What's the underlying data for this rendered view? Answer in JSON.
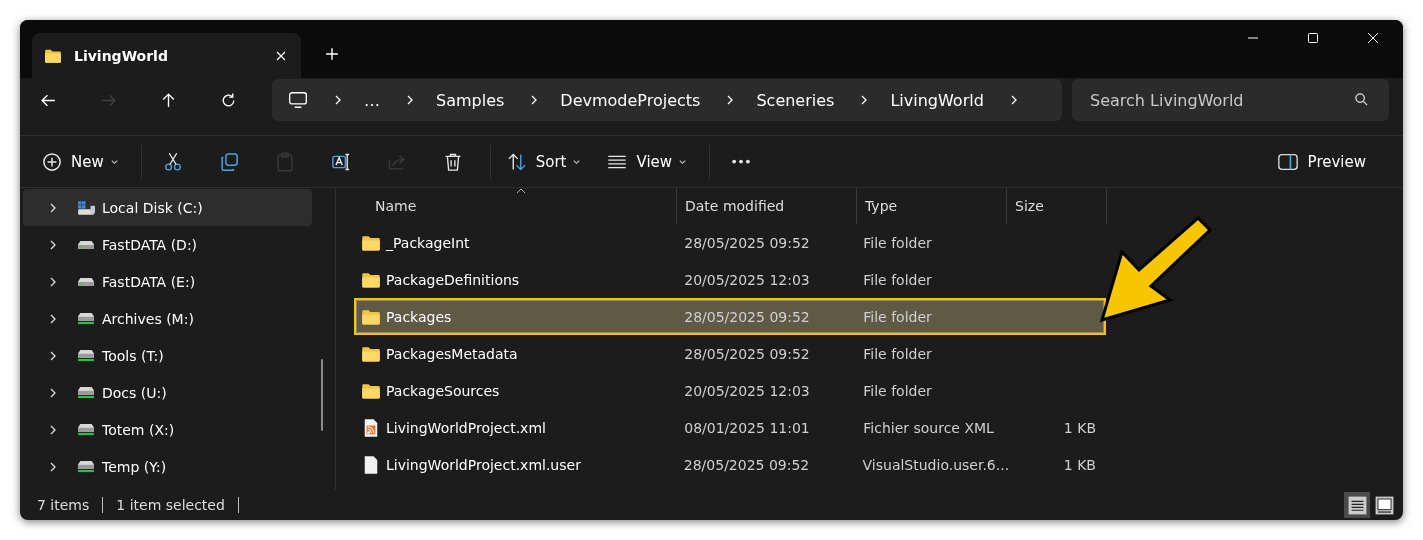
{
  "window": {
    "tab": {
      "title": "LivingWorld",
      "selected": true
    }
  },
  "nav": [
    {
      "kind": "back",
      "disabled": false
    },
    {
      "kind": "forward",
      "disabled": true
    },
    {
      "kind": "up",
      "disabled": false
    },
    {
      "kind": "refresh",
      "disabled": false
    }
  ],
  "breadcrumb": [
    "…",
    "Samples",
    "DevmodeProjects",
    "Sceneries",
    "LivingWorld"
  ],
  "search": {
    "placeholder": "Search LivingWorld"
  },
  "toolbar": [
    {
      "kind": "new",
      "label": "New",
      "disabled": false
    },
    {
      "kind": "cut",
      "disabled": false
    },
    {
      "kind": "copy",
      "disabled": false
    },
    {
      "kind": "paste",
      "disabled": true
    },
    {
      "kind": "rename",
      "disabled": false
    },
    {
      "kind": "share",
      "disabled": true
    },
    {
      "kind": "delete",
      "disabled": false
    },
    {
      "kind": "sort",
      "label": "Sort",
      "disabled": false
    },
    {
      "kind": "view",
      "label": "View",
      "disabled": false
    },
    {
      "kind": "more",
      "disabled": false
    }
  ],
  "preview": {
    "label": "Preview"
  },
  "sidebar": {
    "items": [
      {
        "label": "Local Disk (C:)",
        "kind": "system",
        "selected": true
      },
      {
        "label": "FastDATA (D:)",
        "kind": "drive",
        "selected": false
      },
      {
        "label": "FastDATA (E:)",
        "kind": "drive",
        "selected": false
      },
      {
        "label": "Archives (M:)",
        "kind": "bar",
        "selected": false
      },
      {
        "label": "Tools (T:)",
        "kind": "bar",
        "selected": false
      },
      {
        "label": "Docs (U:)",
        "kind": "bar",
        "selected": false
      },
      {
        "label": "Totem (X:)",
        "kind": "bar",
        "selected": false
      },
      {
        "label": "Temp (Y:)",
        "kind": "bar",
        "selected": false
      }
    ]
  },
  "table": {
    "columns": [
      {
        "label": "Name",
        "sorted": true
      },
      {
        "label": "Date modified",
        "sorted": false
      },
      {
        "label": "Type",
        "sorted": false
      },
      {
        "label": "Size",
        "sorted": false
      }
    ],
    "rows": [
      {
        "kind": "folder",
        "name": "_PackageInt",
        "date": "28/05/2025 09:52",
        "type": "File folder",
        "selected": false
      },
      {
        "kind": "folder",
        "name": "PackageDefinitions",
        "date": "20/05/2025 12:03",
        "type": "File folder",
        "selected": false
      },
      {
        "kind": "folder",
        "name": "Packages",
        "date": "28/05/2025 09:52",
        "type": "File folder",
        "selected": true
      },
      {
        "kind": "folder",
        "name": "PackagesMetadata",
        "date": "28/05/2025 09:52",
        "type": "File folder",
        "selected": false
      },
      {
        "kind": "folder",
        "name": "PackageSources",
        "date": "20/05/2025 12:03",
        "type": "File folder",
        "selected": false
      },
      {
        "kind": "xml",
        "name": "LivingWorldProject.xml",
        "date": "08/01/2025 11:01",
        "type": "Fichier source XML",
        "size": "1 KB",
        "selected": false
      },
      {
        "kind": "file",
        "name": "LivingWorldProject.xml.user",
        "date": "28/05/2025 09:52",
        "type": "VisualStudio.user.6...",
        "size": "1 KB",
        "selected": false
      }
    ]
  },
  "status_bar": {
    "items": [
      "7 items",
      "1 item selected"
    ],
    "views": [
      {
        "kind": "details",
        "selected": true
      },
      {
        "kind": "tiles",
        "selected": false
      }
    ]
  }
}
